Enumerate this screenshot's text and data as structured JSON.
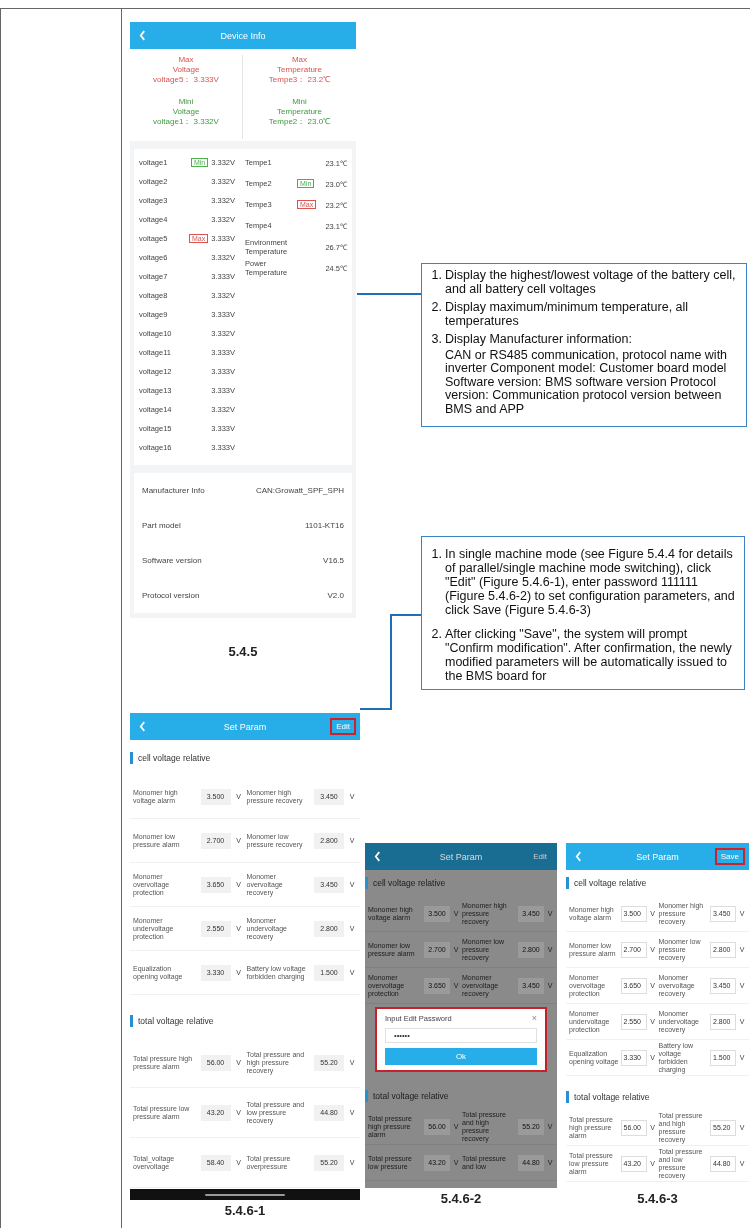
{
  "device_info": {
    "title": "Device Info",
    "summary": [
      {
        "kind": "max",
        "label": "Max",
        "quantity": "Voltage",
        "reading": "voltage5： 3.333V"
      },
      {
        "kind": "max",
        "label": "Max",
        "quantity": "Temperature",
        "reading": "Tempe3： 23.2℃"
      },
      {
        "kind": "min",
        "label": "Mini",
        "quantity": "Voltage",
        "reading": "voltage1： 3.332V"
      },
      {
        "kind": "min",
        "label": "Mini",
        "quantity": "Temperature",
        "reading": "Tempe2： 23.0℃"
      }
    ],
    "voltages": [
      {
        "name": "voltage1",
        "value": "3.332V",
        "badge": "Min",
        "color": "#4cae4c"
      },
      {
        "name": "voltage2",
        "value": "3.332V"
      },
      {
        "name": "voltage3",
        "value": "3.332V"
      },
      {
        "name": "voltage4",
        "value": "3.332V"
      },
      {
        "name": "voltage5",
        "value": "3.333V",
        "badge": "Max",
        "color": "#d9534f"
      },
      {
        "name": "voltage6",
        "value": "3.332V"
      },
      {
        "name": "voltage7",
        "value": "3.333V"
      },
      {
        "name": "voltage8",
        "value": "3.332V"
      },
      {
        "name": "voltage9",
        "value": "3.333V"
      },
      {
        "name": "voltage10",
        "value": "3.332V"
      },
      {
        "name": "voltage11",
        "value": "3.333V"
      },
      {
        "name": "voltage12",
        "value": "3.333V"
      },
      {
        "name": "voltage13",
        "value": "3.333V"
      },
      {
        "name": "voltage14",
        "value": "3.332V"
      },
      {
        "name": "voltage15",
        "value": "3.333V"
      },
      {
        "name": "voltage16",
        "value": "3.333V"
      }
    ],
    "temperatures": [
      {
        "name": "Tempe1",
        "value": "23.1℃"
      },
      {
        "name": "Tempe2",
        "value": "23.0℃",
        "badge": "Min",
        "color": "#4cae4c"
      },
      {
        "name": "Tempe3",
        "value": "23.2℃",
        "badge": "Max",
        "color": "#d9534f"
      },
      {
        "name": "Tempe4",
        "value": "23.1℃"
      },
      {
        "name": "Environment Temperature",
        "value": "26.7℃"
      },
      {
        "name": "Power Temperature",
        "value": "24.5℃"
      }
    ],
    "manufacturer": [
      {
        "label": "Manufacturer Info",
        "value": "CAN:Growatt_SPF_SPH"
      },
      {
        "label": "Part model",
        "value": "1101-KT16"
      },
      {
        "label": "Software version",
        "value": "V16.5"
      },
      {
        "label": "Protocol version",
        "value": "V2.0"
      }
    ],
    "caption": "5.4.5"
  },
  "callouts": [
    {
      "items": [
        {
          "number": "1.",
          "text": "Display the highest/lowest voltage of the battery cell, and all battery cell voltages"
        },
        {
          "number": "2.",
          "text": "Display maximum/minimum temperature, all temperatures"
        },
        {
          "number": "3.",
          "text": "Display Manufacturer information:",
          "detail": "CAN or RS485 communication, protocol name with  inverter Component model: Customer board model Software version: BMS software version  Protocol version: Communication protocol version between BMS and APP"
        }
      ]
    },
    {
      "items": [
        {
          "number": "1.",
          "text": "In single machine mode (see Figure 5.4.4 for details of parallel/single machine mode switching), click \"Edit\" (Figure 5.4.6-1), enter password 111111 (Figure 5.4.6-2) to set configuration parameters, and click Save  (Figure 5.4.6-3)"
        },
        {
          "number": "2.",
          "text": "After clicking \"Save\", the system will prompt \"Confirm modification\". After confirmation, the newly modified parameters will be automatically issued to the BMS board for"
        }
      ]
    }
  ],
  "param_screens": [
    {
      "title": "Set Param",
      "action": "Edit",
      "action_highlighted": true,
      "dimmed": false,
      "editing": false,
      "home_bar": true,
      "caption": "5.4.6-1",
      "sections": [
        {
          "title": "cell voltage relative",
          "rows": [
            [
              {
                "label": "Monomer high voltage alarm",
                "value": "3.500",
                "unit": "V"
              },
              {
                "label": "Monomer high pressure recovery",
                "value": "3.450",
                "unit": "V"
              }
            ],
            [
              {
                "label": "Monomer low pressure alarm",
                "value": "2.700",
                "unit": "V"
              },
              {
                "label": "Monomer low pressure recovery",
                "value": "2.800",
                "unit": "V"
              }
            ],
            [
              {
                "label": "Monomer overvoltage protection",
                "value": "3.650",
                "unit": "V"
              },
              {
                "label": "Monomer overvoltage recovery",
                "value": "3.450",
                "unit": "V"
              }
            ],
            [
              {
                "label": "Monomer undervoltage protection",
                "value": "2.550",
                "unit": "V"
              },
              {
                "label": "Monomer undervoltage recovery",
                "value": "2.800",
                "unit": "V"
              }
            ],
            [
              {
                "label": "Equalization opening voltage",
                "value": "3.330",
                "unit": "V"
              },
              {
                "label": "Battery low voltage forbidden charging",
                "value": "1.500",
                "unit": "V"
              }
            ]
          ]
        },
        {
          "title": "total voltage relative",
          "rows": [
            [
              {
                "label": "Total pressure high pressure alarm",
                "value": "56.00",
                "unit": "V"
              },
              {
                "label": "Total pressure and high pressure recovery",
                "value": "55.20",
                "unit": "V"
              }
            ],
            [
              {
                "label": "Total pressure low pressure alarm",
                "value": "43.20",
                "unit": "V"
              },
              {
                "label": "Total pressure and low pressure recovery",
                "value": "44.80",
                "unit": "V"
              }
            ],
            [
              {
                "label": "Total_voltage overvoltage",
                "value": "58.40",
                "unit": "V"
              },
              {
                "label": "Total pressure overpressure",
                "value": "55.20",
                "unit": "V"
              }
            ]
          ]
        }
      ]
    },
    {
      "title": "Set Param",
      "action": "Edit",
      "action_highlighted": false,
      "dimmed": true,
      "editing": false,
      "caption": "5.4.6-2",
      "dialog": {
        "title": "Input Edit Password",
        "close": "×",
        "value": "••••••",
        "button": "Ok"
      },
      "sections": [
        {
          "title": "cell voltage relative",
          "rows": [
            [
              {
                "label": "Monomer high voltage alarm",
                "value": "3.500",
                "unit": "V"
              },
              {
                "label": "Monomer high pressure recovery",
                "value": "3.450",
                "unit": "V"
              }
            ],
            [
              {
                "label": "Monomer low pressure alarm",
                "value": "2.700",
                "unit": "V"
              },
              {
                "label": "Monomer low pressure recovery",
                "value": "2.800",
                "unit": "V"
              }
            ],
            [
              {
                "label": "Monomer overvoltage protection",
                "value": "3.650",
                "unit": "V"
              },
              {
                "label": "Monomer overvoltage recovery",
                "value": "3.450",
                "unit": "V"
              }
            ]
          ]
        },
        {
          "title": "total voltage relative",
          "rows": [
            [
              {
                "label": "Total pressure high pressure alarm",
                "value": "56.00",
                "unit": "V"
              },
              {
                "label": "Total pressure and high pressure recovery",
                "value": "55.20",
                "unit": "V"
              }
            ],
            [
              {
                "label": "Total pressure low pressure",
                "value": "43.20",
                "unit": "V"
              },
              {
                "label": "Total pressure and low",
                "value": "44.80",
                "unit": "V"
              }
            ]
          ]
        }
      ]
    },
    {
      "title": "Set Param",
      "action": "Save",
      "action_highlighted": true,
      "dimmed": false,
      "editing": true,
      "caption": "5.4.6-3",
      "sections": [
        {
          "title": "cell voltage relative",
          "rows": [
            [
              {
                "label": "Monomer high voltage alarm",
                "value": "3.500",
                "unit": "V"
              },
              {
                "label": "Monomer high pressure recovery",
                "value": "3.450",
                "unit": "V"
              }
            ],
            [
              {
                "label": "Monomer low pressure alarm",
                "value": "2.700",
                "unit": "V"
              },
              {
                "label": "Monomer low pressure recovery",
                "value": "2.800",
                "unit": "V"
              }
            ],
            [
              {
                "label": "Monomer overvoltage protection",
                "value": "3.650",
                "unit": "V"
              },
              {
                "label": "Monomer overvoltage recovery",
                "value": "3.450",
                "unit": "V"
              }
            ],
            [
              {
                "label": "Monomer undervoltage protection",
                "value": "2.550",
                "unit": "V"
              },
              {
                "label": "Monomer undervoltage recovery",
                "value": "2.800",
                "unit": "V"
              }
            ],
            [
              {
                "label": "Equalization opening voltage",
                "value": "3.330",
                "unit": "V"
              },
              {
                "label": "Battery low voltage forbidden charging",
                "value": "1.500",
                "unit": "V"
              }
            ]
          ]
        },
        {
          "title": "total voltage relative",
          "rows": [
            [
              {
                "label": "Total pressure high pressure alarm",
                "value": "56.00",
                "unit": "V"
              },
              {
                "label": "Total pressure and high pressure recovery",
                "value": "55.20",
                "unit": "V"
              }
            ],
            [
              {
                "label": "Total pressure low pressure alarm",
                "value": "43.20",
                "unit": "V"
              },
              {
                "label": "Total pressure and low pressure recovery",
                "value": "44.80",
                "unit": "V"
              }
            ]
          ]
        }
      ]
    }
  ]
}
